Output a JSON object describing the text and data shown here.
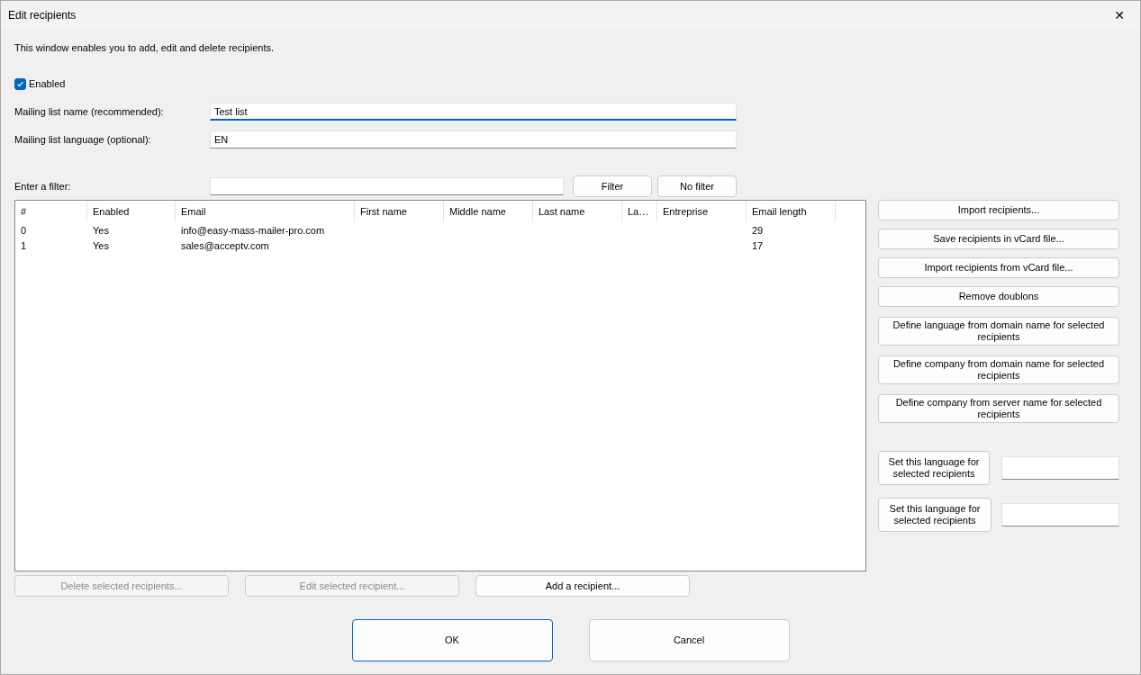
{
  "window": {
    "title": "Edit recipients",
    "close": "✕"
  },
  "description": "This window enables you to add, edit and delete recipients.",
  "enabled_checkbox": {
    "label": "Enabled",
    "checked": true
  },
  "fields": [
    {
      "label": "Mailing list name (recommended):",
      "value": "Test list",
      "focused": true
    },
    {
      "label": "Mailing list language (optional):",
      "value": "EN",
      "focused": false
    }
  ],
  "filter": {
    "label": "Enter a filter:",
    "buttons": [
      "Filter",
      "No filter"
    ]
  },
  "table": {
    "columns": [
      "#",
      "Enabled",
      "Email",
      "First name",
      "Middle name",
      "Last name",
      "La…",
      "Entreprise",
      "Email length"
    ],
    "rows": [
      [
        "0",
        "Yes",
        "info@easy-mass-mailer-pro.com",
        "",
        "",
        "",
        "",
        "",
        "29"
      ],
      [
        "1",
        "Yes",
        "sales@acceptv.com",
        "",
        "",
        "",
        "",
        "",
        "17"
      ]
    ]
  },
  "table_buttons": [
    {
      "label": "Delete selected recipients...",
      "disabled": true
    },
    {
      "label": "Edit selected recipient...",
      "disabled": true
    },
    {
      "label": "Add a recipient...",
      "disabled": false
    }
  ],
  "side_buttons": [
    {
      "label": "Import recipients..."
    },
    {
      "label": "Save recipients in vCard file..."
    },
    {
      "label": "Import recipients from vCard file..."
    },
    {
      "label": "Remove doublons"
    },
    {
      "label": "Define language from domain name for selected recipients"
    },
    {
      "label": "Define company from domain name for selected recipients"
    },
    {
      "label": "Define company from server name for selected recipients"
    }
  ],
  "language_setters": [
    {
      "label": "Set this language for selected recipients"
    },
    {
      "label": "Set this language for selected recipients"
    }
  ],
  "dialog_buttons": [
    {
      "label": "OK",
      "default": true
    },
    {
      "label": "Cancel",
      "default": false
    }
  ]
}
